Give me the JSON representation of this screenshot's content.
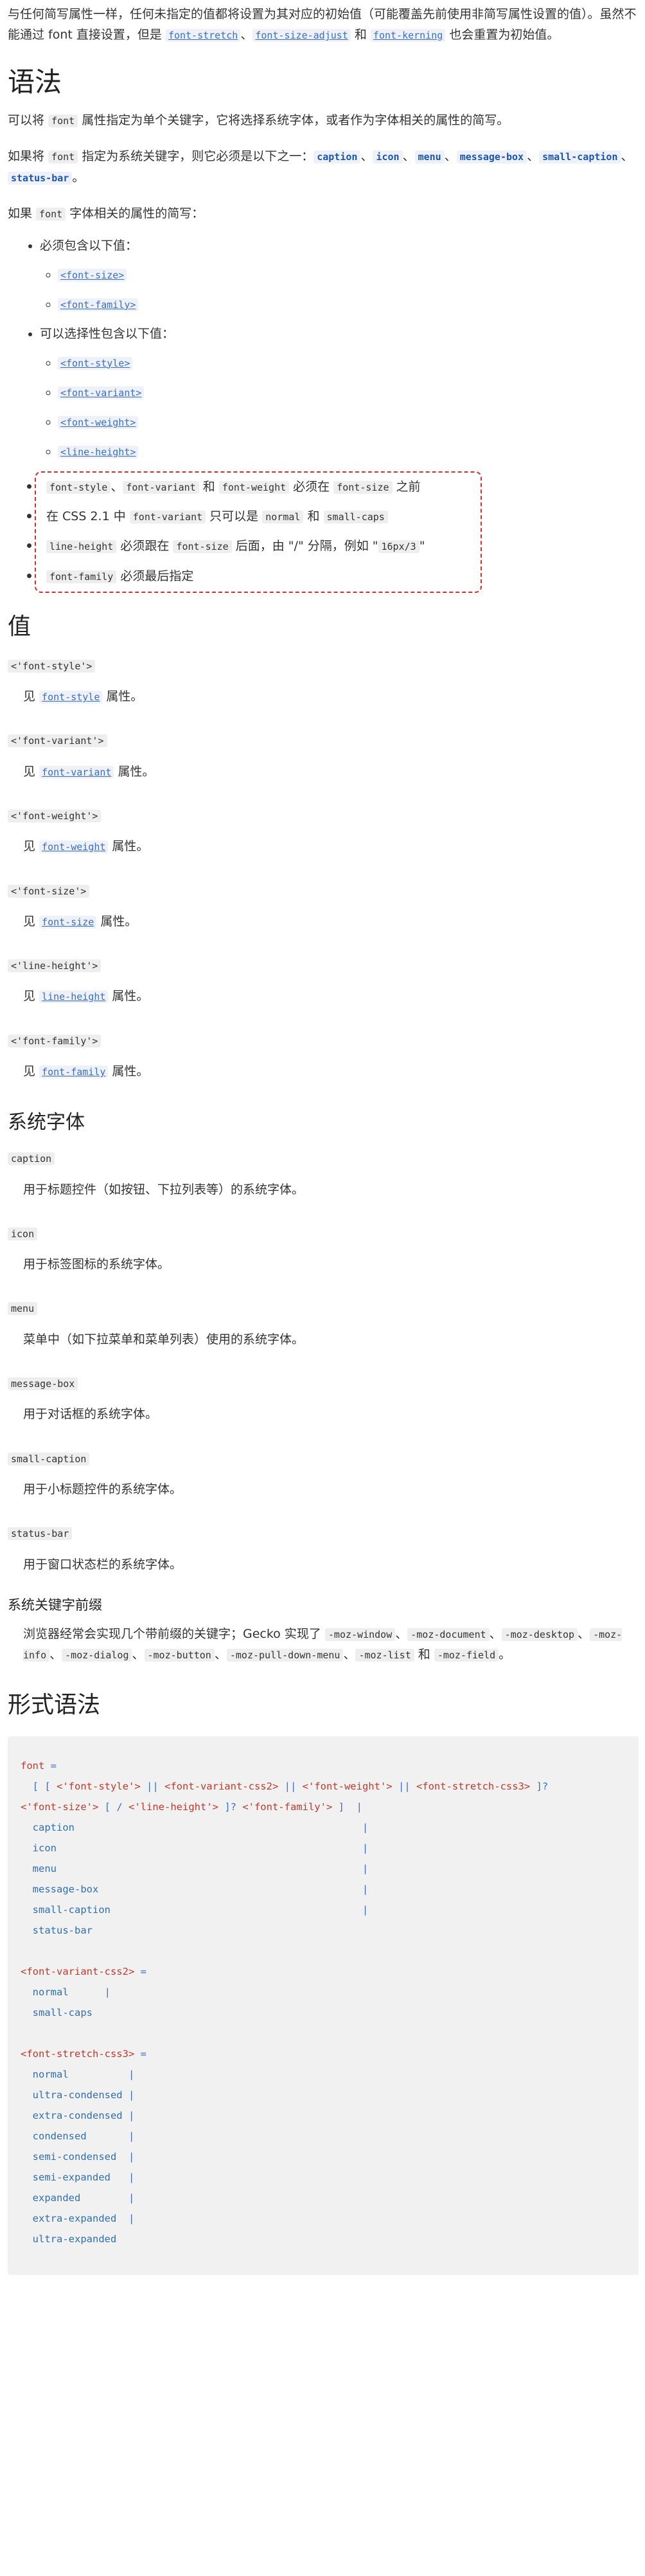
{
  "intro": {
    "t1": "与任何简写属性一样，任何未指定的值都将设置为其对应的初始值（可能覆盖先前使用非简写属性设置的值）。虽然不能通过 font 直接设置，但是 ",
    "l1": "font-stretch",
    "t2": "、",
    "l2": "font-size-adjust",
    "t3": " 和 ",
    "l3": "font-kerning",
    "t4": " 也会重置为初始值。"
  },
  "syntax_section": {
    "heading": "语法",
    "p1_a": "可以将 ",
    "p1_code": "font",
    "p1_b": " 属性指定为单个关键字，它将选择系统字体，或者作为字体相关的属性的简写。",
    "p2_a": "如果将 ",
    "p2_code": "font",
    "p2_b": " 指定为系统关键字，则它必须是以下之一：",
    "p2_keywords": [
      "caption",
      "icon",
      "menu",
      "message-box",
      "small-caption",
      "status-bar"
    ],
    "p2_sep": "、",
    "p2_end": "。",
    "p3_a": "如果 ",
    "p3_code": "font",
    "p3_b": " 字体相关的属性的简写：",
    "required_label": "必须包含以下值：",
    "required_items": [
      "<font-size>",
      "<font-family>"
    ],
    "optional_label": "可以选择性包含以下值：",
    "optional_items": [
      "<font-style>",
      "<font-variant>",
      "<font-weight>",
      "<line-height>"
    ],
    "rules": {
      "r1_c1": "font-style",
      "r1_sep": "、",
      "r1_c2": "font-variant",
      "r1_and": " 和 ",
      "r1_c3": "font-weight",
      "r1_mid": " 必须在 ",
      "r1_c4": "font-size",
      "r1_end": " 之前",
      "r2_a": "在 CSS 2.1 中 ",
      "r2_c1": "font-variant",
      "r2_b": " 只可以是 ",
      "r2_c2": "normal",
      "r2_and": " 和 ",
      "r2_c3": "small-caps",
      "r3_c1": "line-height",
      "r3_a": " 必须跟在 ",
      "r3_c2": "font-size",
      "r3_b": " 后面，由 \"/\" 分隔，例如 \"",
      "r3_c3": "16px/3",
      "r3_end": "\"",
      "r4_c1": "font-family",
      "r4_a": " 必须最后指定"
    }
  },
  "values_section": {
    "heading": "值",
    "see_prefix": "见 ",
    "see_suffix": " 属性。",
    "items": [
      {
        "term": "<'font-style'>",
        "link": "font-style"
      },
      {
        "term": "<'font-variant'>",
        "link": "font-variant"
      },
      {
        "term": "<'font-weight'>",
        "link": "font-weight"
      },
      {
        "term": "<'font-size'>",
        "link": "font-size"
      },
      {
        "term": "<'line-height'>",
        "link": "line-height"
      },
      {
        "term": "<'font-family'>",
        "link": "font-family"
      }
    ]
  },
  "system_fonts": {
    "heading": "系统字体",
    "items": [
      {
        "term": "caption",
        "desc": "用于标题控件（如按钮、下拉列表等）的系统字体。"
      },
      {
        "term": "icon",
        "desc": "用于标签图标的系统字体。"
      },
      {
        "term": "menu",
        "desc": "菜单中（如下拉菜单和菜单列表）使用的系统字体。"
      },
      {
        "term": "message-box",
        "desc": "用于对话框的系统字体。"
      },
      {
        "term": "small-caption",
        "desc": "用于小标题控件的系统字体。"
      },
      {
        "term": "status-bar",
        "desc": "用于窗口状态栏的系统字体。"
      }
    ],
    "prefix_heading": "系统关键字前缀",
    "prefix_text": "浏览器经常会实现几个带前缀的关键字；Gecko 实现了 ",
    "prefix_keywords": [
      "-moz-window",
      "-moz-document",
      "-moz-desktop",
      "-moz-info",
      "-moz-dialog",
      "-moz-button",
      "-moz-pull-down-menu",
      "-moz-list",
      "-moz-field"
    ],
    "prefix_sep": "、",
    "prefix_and": " 和 ",
    "prefix_end": "。"
  },
  "formal_syntax": {
    "heading": "形式语法",
    "lines": [
      [
        {
          "c": "prop",
          "t": "font"
        },
        {
          "c": "op",
          "t": " ="
        }
      ],
      [
        {
          "c": "op",
          "t": "  [ [ "
        },
        {
          "c": "opt",
          "t": "<'font-style'>"
        },
        {
          "c": "sep",
          "t": " || "
        },
        {
          "c": "opt",
          "t": "<font-variant-css2>"
        },
        {
          "c": "sep",
          "t": " || "
        },
        {
          "c": "opt",
          "t": "<'font-weight'>"
        },
        {
          "c": "sep",
          "t": " || "
        },
        {
          "c": "opt",
          "t": "<font-stretch-css3>"
        },
        {
          "c": "op",
          "t": " ]?"
        }
      ],
      [
        {
          "c": "opt",
          "t": "<'font-size'>"
        },
        {
          "c": "op",
          "t": " [ / "
        },
        {
          "c": "opt",
          "t": "<'line-height'>"
        },
        {
          "c": "op",
          "t": " ]? "
        },
        {
          "c": "opt",
          "t": "<'font-family'>"
        },
        {
          "c": "op",
          "t": " ]  |"
        }
      ],
      [
        {
          "c": "val",
          "t": "  caption"
        },
        {
          "c": "sep",
          "t": "                                                |"
        }
      ],
      [
        {
          "c": "val",
          "t": "  icon"
        },
        {
          "c": "sep",
          "t": "                                                   |"
        }
      ],
      [
        {
          "c": "val",
          "t": "  menu"
        },
        {
          "c": "sep",
          "t": "                                                   |"
        }
      ],
      [
        {
          "c": "val",
          "t": "  message-box"
        },
        {
          "c": "sep",
          "t": "                                            |"
        }
      ],
      [
        {
          "c": "val",
          "t": "  small-caption"
        },
        {
          "c": "sep",
          "t": "                                          |"
        }
      ],
      [
        {
          "c": "val",
          "t": "  status-bar"
        }
      ],
      [
        {
          "c": "val",
          "t": " "
        }
      ],
      [
        {
          "c": "prop",
          "t": "<font-variant-css2>"
        },
        {
          "c": "op",
          "t": " ="
        }
      ],
      [
        {
          "c": "val",
          "t": "  normal"
        },
        {
          "c": "sep",
          "t": "      |"
        }
      ],
      [
        {
          "c": "val",
          "t": "  small-caps"
        }
      ],
      [
        {
          "c": "val",
          "t": " "
        }
      ],
      [
        {
          "c": "prop",
          "t": "<font-stretch-css3>"
        },
        {
          "c": "op",
          "t": " ="
        }
      ],
      [
        {
          "c": "val",
          "t": "  normal"
        },
        {
          "c": "sep",
          "t": "          |"
        }
      ],
      [
        {
          "c": "val",
          "t": "  ultra-condensed"
        },
        {
          "c": "sep",
          "t": " |"
        }
      ],
      [
        {
          "c": "val",
          "t": "  extra-condensed"
        },
        {
          "c": "sep",
          "t": " |"
        }
      ],
      [
        {
          "c": "val",
          "t": "  condensed"
        },
        {
          "c": "sep",
          "t": "       |"
        }
      ],
      [
        {
          "c": "val",
          "t": "  semi-condensed"
        },
        {
          "c": "sep",
          "t": "  |"
        }
      ],
      [
        {
          "c": "val",
          "t": "  semi-expanded"
        },
        {
          "c": "sep",
          "t": "   |"
        }
      ],
      [
        {
          "c": "val",
          "t": "  expanded"
        },
        {
          "c": "sep",
          "t": "        |"
        }
      ],
      [
        {
          "c": "val",
          "t": "  extra-expanded"
        },
        {
          "c": "sep",
          "t": "  |"
        }
      ],
      [
        {
          "c": "val",
          "t": "  ultra-expanded"
        }
      ]
    ]
  }
}
